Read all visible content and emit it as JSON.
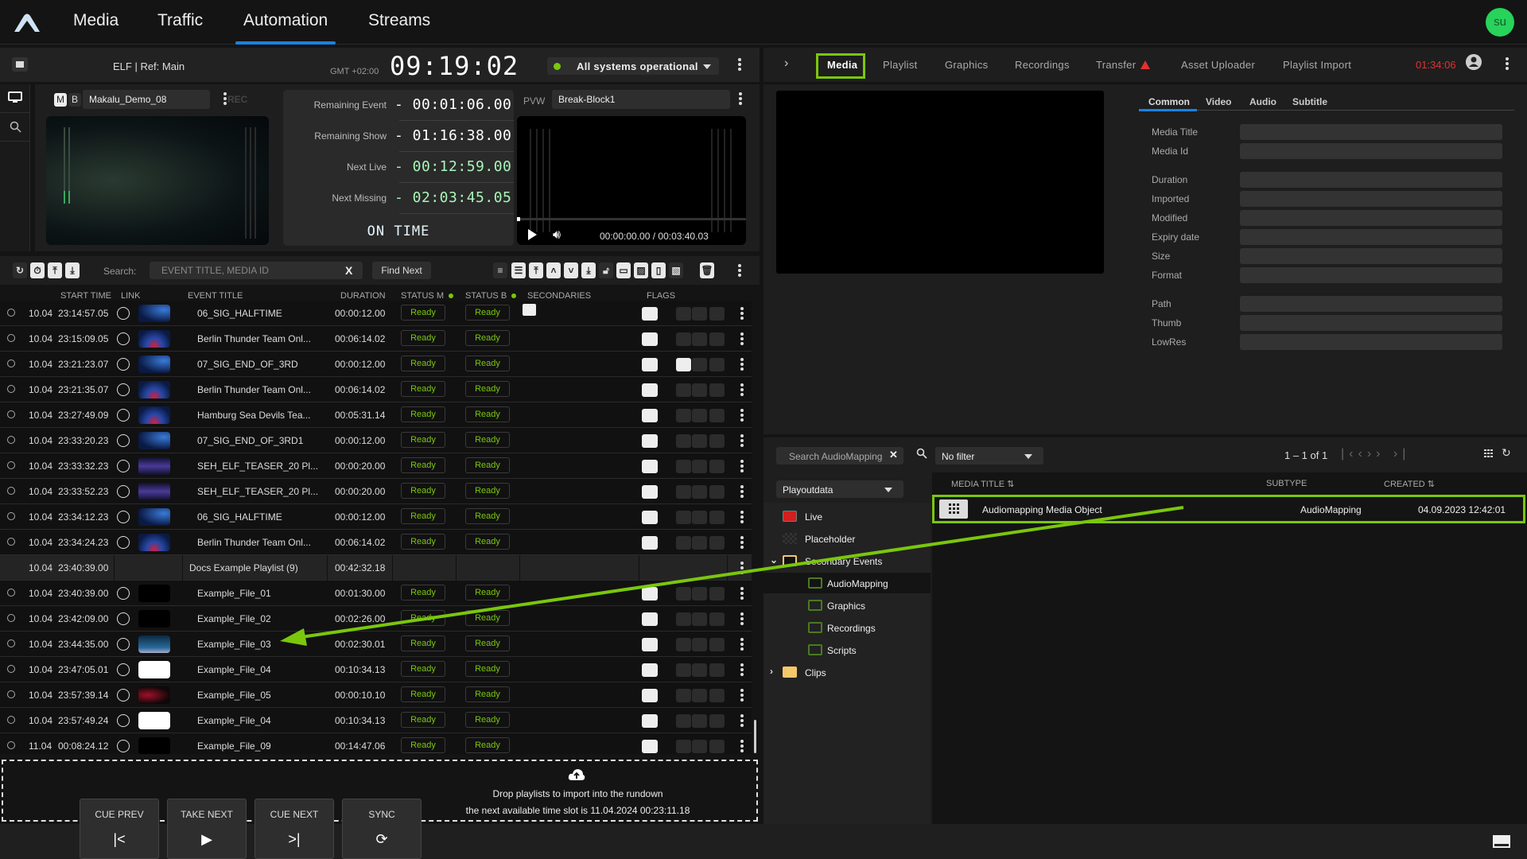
{
  "nav": {
    "tabs": [
      "Media",
      "Traffic",
      "Automation",
      "Streams"
    ],
    "active": "Automation",
    "user_initials": "su"
  },
  "header": {
    "channel": "ELF | Ref: Main",
    "timezone": "GMT +02:00",
    "clock": "09:19:02",
    "system_status": "All systems operational"
  },
  "player": {
    "pgm_badges": [
      "M",
      "B"
    ],
    "pgm_name": "Makalu_Demo_08",
    "rec_label": "REC",
    "times": [
      {
        "label": "Remaining Event",
        "value": "- 00:01:06.00"
      },
      {
        "label": "Remaining Show",
        "value": "- 01:16:38.00"
      },
      {
        "label": "Next Live",
        "value": "- 00:12:59.00"
      },
      {
        "label": "Next Missing",
        "value": "- 02:03:45.05"
      }
    ],
    "on_time": "ON TIME",
    "pvw_label": "PVW",
    "pvw_name": "Break-Block1",
    "pvw_timecode": "00:00:00.00 / 00:03:40.03",
    "pvw_progress": 0
  },
  "toolbar": {
    "search_label": "Search:",
    "search_placeholder": "EVENT TITLE, MEDIA ID",
    "search_clear": "X",
    "find_next": "Find Next"
  },
  "columns": {
    "start_time": "START TIME",
    "link": "LINK",
    "event_title": "EVENT TITLE",
    "duration": "DURATION",
    "status_m": "STATUS M",
    "status_b": "STATUS B",
    "secondaries": "SECONDARIES",
    "flags": "FLAGS"
  },
  "rows": [
    {
      "date": "10.04",
      "time": "23:14:57.05",
      "title": "06_SIG_HALFTIME",
      "duration": "00:00:12.00",
      "status_m": "Ready",
      "status_b": "Ready",
      "thumb": "blue",
      "secondary": true
    },
    {
      "date": "10.04",
      "time": "23:15:09.05",
      "title": "Berlin Thunder Team Onl...",
      "duration": "00:06:14.02",
      "status_m": "Ready",
      "status_b": "Ready",
      "thumb": "blue-red"
    },
    {
      "date": "10.04",
      "time": "23:21:23.07",
      "title": "07_SIG_END_OF_3RD",
      "duration": "00:00:12.00",
      "status_m": "Ready",
      "status_b": "Ready",
      "thumb": "blue",
      "flag_on": true
    },
    {
      "date": "10.04",
      "time": "23:21:35.07",
      "title": "Berlin Thunder Team Onl...",
      "duration": "00:06:14.02",
      "status_m": "Ready",
      "status_b": "Ready",
      "thumb": "blue-red"
    },
    {
      "date": "10.04",
      "time": "23:27:49.09",
      "title": "Hamburg Sea Devils Tea...",
      "duration": "00:05:31.14",
      "status_m": "Ready",
      "status_b": "Ready",
      "thumb": "blue-red"
    },
    {
      "date": "10.04",
      "time": "23:33:20.23",
      "title": "07_SIG_END_OF_3RD1",
      "duration": "00:00:12.00",
      "status_m": "Ready",
      "status_b": "Ready",
      "thumb": "blue"
    },
    {
      "date": "10.04",
      "time": "23:33:32.23",
      "title": "SEH_ELF_TEASER_20 Pl...",
      "duration": "00:00:20.00",
      "status_m": "Ready",
      "status_b": "Ready",
      "thumb": "purple"
    },
    {
      "date": "10.04",
      "time": "23:33:52.23",
      "title": "SEH_ELF_TEASER_20 Pl...",
      "duration": "00:00:20.00",
      "status_m": "Ready",
      "status_b": "Ready",
      "thumb": "purple"
    },
    {
      "date": "10.04",
      "time": "23:34:12.23",
      "title": "06_SIG_HALFTIME",
      "duration": "00:00:12.00",
      "status_m": "Ready",
      "status_b": "Ready",
      "thumb": "blue"
    },
    {
      "date": "10.04",
      "time": "23:34:24.23",
      "title": "Berlin Thunder Team Onl...",
      "duration": "00:06:14.02",
      "status_m": "Ready",
      "status_b": "Ready",
      "thumb": "blue-red"
    },
    {
      "group": true,
      "date": "10.04",
      "time": "23:40:39.00",
      "title": "Docs Example Playlist (9)",
      "duration": "00:42:32.18"
    },
    {
      "date": "10.04",
      "time": "23:40:39.00",
      "title": "Example_File_01",
      "duration": "00:01:30.00",
      "status_m": "Ready",
      "status_b": "Ready",
      "thumb": "black"
    },
    {
      "date": "10.04",
      "time": "23:42:09.00",
      "title": "Example_File_02",
      "duration": "00:02:26.00",
      "status_m": "Ready",
      "status_b": "Ready",
      "thumb": "black"
    },
    {
      "date": "10.04",
      "time": "23:44:35.00",
      "title": "Example_File_03",
      "duration": "00:02:30.01",
      "status_m": "Ready",
      "status_b": "Ready",
      "thumb": "sky"
    },
    {
      "date": "10.04",
      "time": "23:47:05.01",
      "title": "Example_File_04",
      "duration": "00:10:34.13",
      "status_m": "Ready",
      "status_b": "Ready",
      "thumb": "white"
    },
    {
      "date": "10.04",
      "time": "23:57:39.14",
      "title": "Example_File_05",
      "duration": "00:00:10.10",
      "status_m": "Ready",
      "status_b": "Ready",
      "thumb": "red"
    },
    {
      "date": "10.04",
      "time": "23:57:49.24",
      "title": "Example_File_04",
      "duration": "00:10:34.13",
      "status_m": "Ready",
      "status_b": "Ready",
      "thumb": "white"
    },
    {
      "date": "11.04",
      "time": "00:08:24.12",
      "title": "Example_File_09",
      "duration": "00:14:47.06",
      "status_m": "Ready",
      "status_b": "Ready",
      "thumb": "black"
    }
  ],
  "dropzone": {
    "line1": "Drop playlists to import into the rundown",
    "line2": "the next available time slot is 11.04.2024 00:23:11.18"
  },
  "controls": [
    {
      "label": "CUE PREV",
      "icon": "|<"
    },
    {
      "label": "TAKE NEXT",
      "icon": "▶"
    },
    {
      "label": "CUE NEXT",
      "icon": ">|"
    },
    {
      "label": "SYNC",
      "icon": "⟳"
    }
  ],
  "right_tabs": {
    "items": [
      "Media",
      "Playlist",
      "Graphics",
      "Recordings",
      "Transfer",
      "Asset Uploader",
      "Playlist Import"
    ],
    "active": "Media",
    "session_time": "01:34:06"
  },
  "media_tabs": [
    "Common",
    "Video",
    "Audio",
    "Subtitle"
  ],
  "meta_fields": [
    "Media Title",
    "Media Id",
    "Duration",
    "Imported",
    "Modified",
    "Expiry date",
    "Size",
    "Format",
    "Path",
    "Thumb",
    "LowRes"
  ],
  "browser": {
    "search_value": "Search AudioMapping",
    "filter": "No filter",
    "pager": "1 – 1 of 1",
    "source": "Playoutdata",
    "tree": [
      {
        "label": "Live",
        "level": 0,
        "icon": "live"
      },
      {
        "label": "Placeholder",
        "level": 0,
        "icon": "checker"
      },
      {
        "label": "Secondary Events",
        "level": 0,
        "icon": "folder-open",
        "expanded": true
      },
      {
        "label": "AudioMapping",
        "level": 1,
        "icon": "folder-green",
        "selected": true
      },
      {
        "label": "Graphics",
        "level": 1,
        "icon": "folder-green"
      },
      {
        "label": "Recordings",
        "level": 1,
        "icon": "folder-green"
      },
      {
        "label": "Scripts",
        "level": 1,
        "icon": "folder-green"
      },
      {
        "label": "Clips",
        "level": 0,
        "icon": "folder-yellow",
        "collapsed": true
      }
    ],
    "columns": {
      "title": "MEDIA TITLE",
      "subtype": "SUBTYPE",
      "created": "CREATED"
    },
    "results": [
      {
        "title": "Audiomapping Media Object",
        "subtype": "AudioMapping",
        "created": "04.09.2023 12:42:01"
      }
    ]
  },
  "colors": {
    "accent_blue": "#1a82e2",
    "highlight_green": "#7ac70c",
    "status_ready": "#7ac70c",
    "alert_red": "#e53030",
    "avatar_green": "#27d35a"
  }
}
